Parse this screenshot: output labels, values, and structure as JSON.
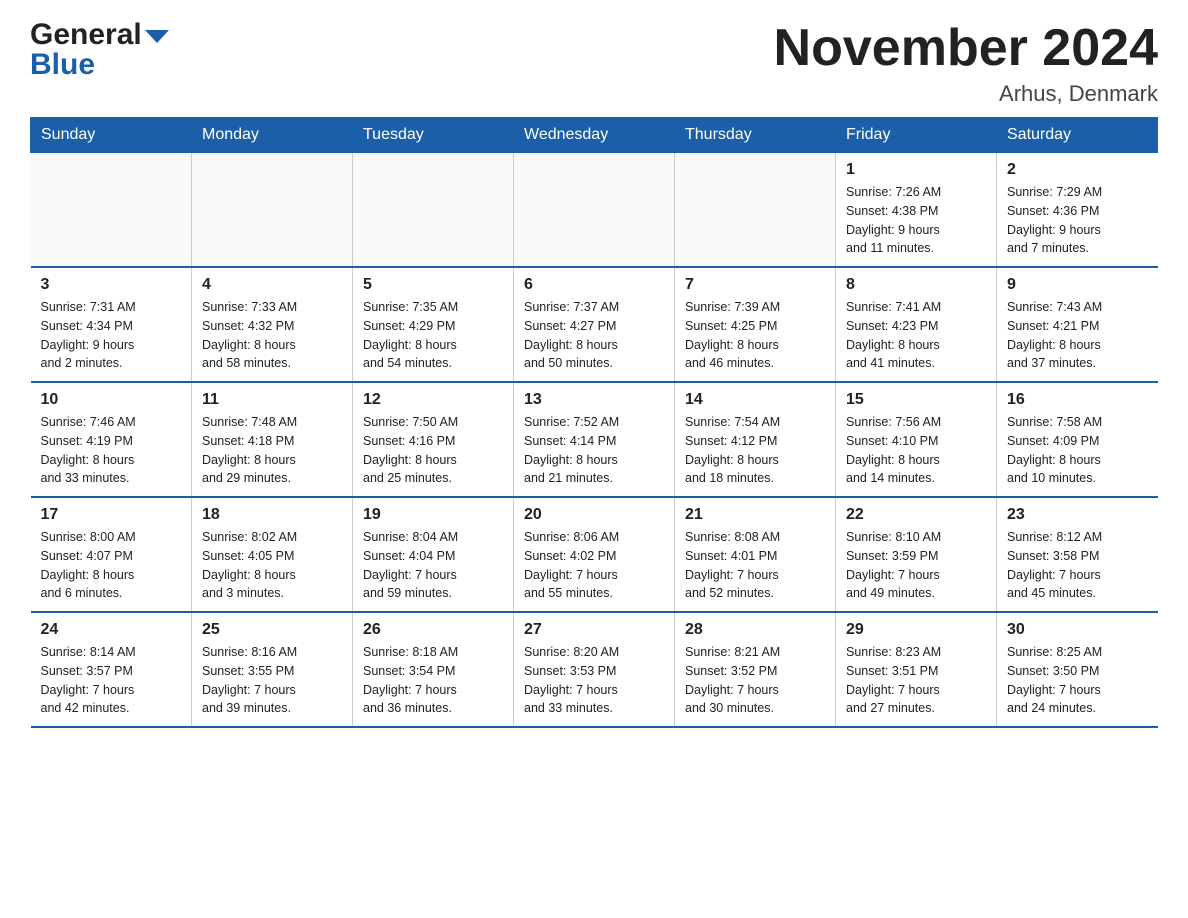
{
  "header": {
    "logo_general": "General",
    "logo_blue": "Blue",
    "month_title": "November 2024",
    "location": "Arhus, Denmark"
  },
  "weekdays": [
    "Sunday",
    "Monday",
    "Tuesday",
    "Wednesday",
    "Thursday",
    "Friday",
    "Saturday"
  ],
  "weeks": [
    [
      {
        "day": "",
        "info": ""
      },
      {
        "day": "",
        "info": ""
      },
      {
        "day": "",
        "info": ""
      },
      {
        "day": "",
        "info": ""
      },
      {
        "day": "",
        "info": ""
      },
      {
        "day": "1",
        "info": "Sunrise: 7:26 AM\nSunset: 4:38 PM\nDaylight: 9 hours\nand 11 minutes."
      },
      {
        "day": "2",
        "info": "Sunrise: 7:29 AM\nSunset: 4:36 PM\nDaylight: 9 hours\nand 7 minutes."
      }
    ],
    [
      {
        "day": "3",
        "info": "Sunrise: 7:31 AM\nSunset: 4:34 PM\nDaylight: 9 hours\nand 2 minutes."
      },
      {
        "day": "4",
        "info": "Sunrise: 7:33 AM\nSunset: 4:32 PM\nDaylight: 8 hours\nand 58 minutes."
      },
      {
        "day": "5",
        "info": "Sunrise: 7:35 AM\nSunset: 4:29 PM\nDaylight: 8 hours\nand 54 minutes."
      },
      {
        "day": "6",
        "info": "Sunrise: 7:37 AM\nSunset: 4:27 PM\nDaylight: 8 hours\nand 50 minutes."
      },
      {
        "day": "7",
        "info": "Sunrise: 7:39 AM\nSunset: 4:25 PM\nDaylight: 8 hours\nand 46 minutes."
      },
      {
        "day": "8",
        "info": "Sunrise: 7:41 AM\nSunset: 4:23 PM\nDaylight: 8 hours\nand 41 minutes."
      },
      {
        "day": "9",
        "info": "Sunrise: 7:43 AM\nSunset: 4:21 PM\nDaylight: 8 hours\nand 37 minutes."
      }
    ],
    [
      {
        "day": "10",
        "info": "Sunrise: 7:46 AM\nSunset: 4:19 PM\nDaylight: 8 hours\nand 33 minutes."
      },
      {
        "day": "11",
        "info": "Sunrise: 7:48 AM\nSunset: 4:18 PM\nDaylight: 8 hours\nand 29 minutes."
      },
      {
        "day": "12",
        "info": "Sunrise: 7:50 AM\nSunset: 4:16 PM\nDaylight: 8 hours\nand 25 minutes."
      },
      {
        "day": "13",
        "info": "Sunrise: 7:52 AM\nSunset: 4:14 PM\nDaylight: 8 hours\nand 21 minutes."
      },
      {
        "day": "14",
        "info": "Sunrise: 7:54 AM\nSunset: 4:12 PM\nDaylight: 8 hours\nand 18 minutes."
      },
      {
        "day": "15",
        "info": "Sunrise: 7:56 AM\nSunset: 4:10 PM\nDaylight: 8 hours\nand 14 minutes."
      },
      {
        "day": "16",
        "info": "Sunrise: 7:58 AM\nSunset: 4:09 PM\nDaylight: 8 hours\nand 10 minutes."
      }
    ],
    [
      {
        "day": "17",
        "info": "Sunrise: 8:00 AM\nSunset: 4:07 PM\nDaylight: 8 hours\nand 6 minutes."
      },
      {
        "day": "18",
        "info": "Sunrise: 8:02 AM\nSunset: 4:05 PM\nDaylight: 8 hours\nand 3 minutes."
      },
      {
        "day": "19",
        "info": "Sunrise: 8:04 AM\nSunset: 4:04 PM\nDaylight: 7 hours\nand 59 minutes."
      },
      {
        "day": "20",
        "info": "Sunrise: 8:06 AM\nSunset: 4:02 PM\nDaylight: 7 hours\nand 55 minutes."
      },
      {
        "day": "21",
        "info": "Sunrise: 8:08 AM\nSunset: 4:01 PM\nDaylight: 7 hours\nand 52 minutes."
      },
      {
        "day": "22",
        "info": "Sunrise: 8:10 AM\nSunset: 3:59 PM\nDaylight: 7 hours\nand 49 minutes."
      },
      {
        "day": "23",
        "info": "Sunrise: 8:12 AM\nSunset: 3:58 PM\nDaylight: 7 hours\nand 45 minutes."
      }
    ],
    [
      {
        "day": "24",
        "info": "Sunrise: 8:14 AM\nSunset: 3:57 PM\nDaylight: 7 hours\nand 42 minutes."
      },
      {
        "day": "25",
        "info": "Sunrise: 8:16 AM\nSunset: 3:55 PM\nDaylight: 7 hours\nand 39 minutes."
      },
      {
        "day": "26",
        "info": "Sunrise: 8:18 AM\nSunset: 3:54 PM\nDaylight: 7 hours\nand 36 minutes."
      },
      {
        "day": "27",
        "info": "Sunrise: 8:20 AM\nSunset: 3:53 PM\nDaylight: 7 hours\nand 33 minutes."
      },
      {
        "day": "28",
        "info": "Sunrise: 8:21 AM\nSunset: 3:52 PM\nDaylight: 7 hours\nand 30 minutes."
      },
      {
        "day": "29",
        "info": "Sunrise: 8:23 AM\nSunset: 3:51 PM\nDaylight: 7 hours\nand 27 minutes."
      },
      {
        "day": "30",
        "info": "Sunrise: 8:25 AM\nSunset: 3:50 PM\nDaylight: 7 hours\nand 24 minutes."
      }
    ]
  ]
}
